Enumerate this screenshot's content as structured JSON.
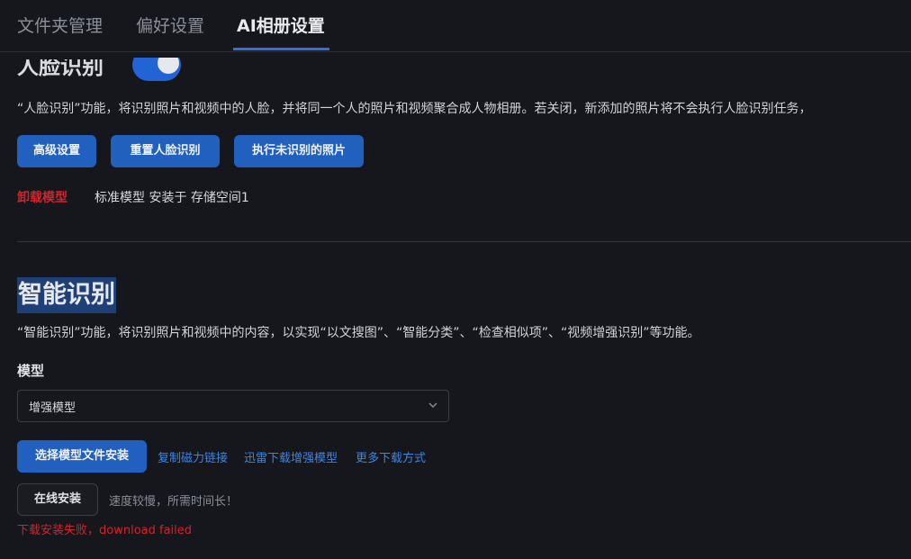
{
  "tabs": [
    {
      "label": "文件夹管理"
    },
    {
      "label": "偏好设置"
    },
    {
      "label": "AI相册设置"
    }
  ],
  "face": {
    "title": "人脸识别",
    "enabled": true,
    "description": "“人脸识别”功能，将识别照片和视频中的人脸，并将同一个人的照片和视频聚合成人物相册。若关闭，新添加的照片将不会执行人脸识别任务，",
    "buttons": {
      "advanced": "高级设置",
      "reset": "重置人脸识别",
      "run_unrecognized": "执行未识别的照片"
    },
    "unload_label": "卸载模型",
    "model_info": "标准模型 安装于 存储空间1"
  },
  "smart": {
    "title": "智能识别",
    "description": "“智能识别”功能，将识别照片和视频中的内容，以实现“以文搜图”、“智能分类”、“检查相似项”、“视频增强识别”等功能。",
    "model_label": "模型",
    "model_selected": "增强模型",
    "select_file_button": "选择模型文件安装",
    "links": {
      "copy_magnet": "复制磁力链接",
      "thunder_download": "迅雷下载增强模型",
      "more_download": "更多下载方式"
    },
    "online_install_button": "在线安装",
    "online_hint": "速度较慢，所需时间长！",
    "error_message": "下载安装失败，download failed"
  },
  "colors": {
    "accent": "#2160bf",
    "link": "#3a86e6",
    "danger": "#d3222a",
    "background": "#15171c"
  }
}
